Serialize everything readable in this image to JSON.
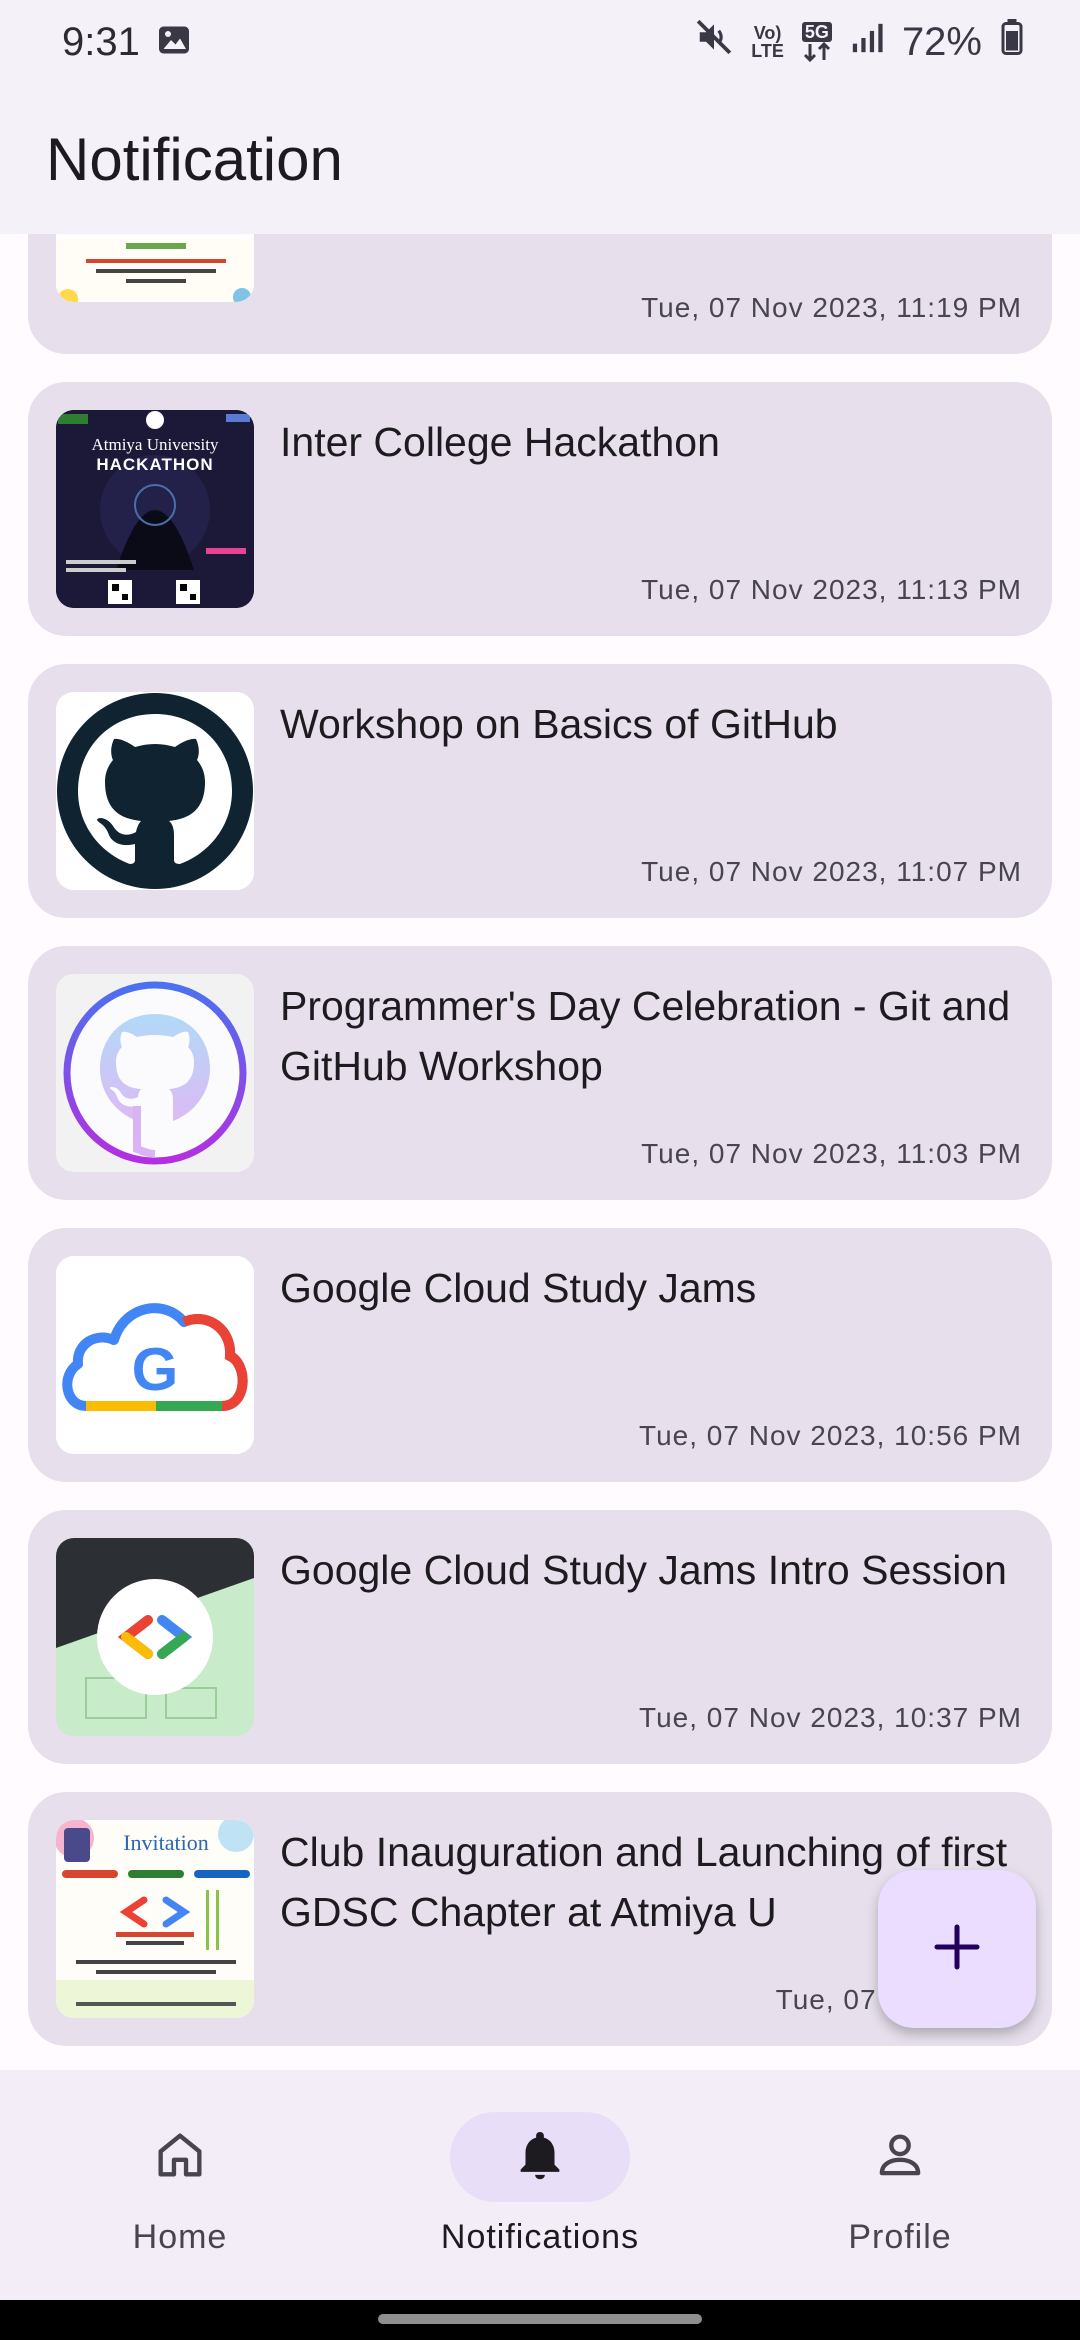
{
  "status_bar": {
    "time": "9:31",
    "volte_top": "Vo)",
    "volte_bottom": "LTE",
    "network": "5G",
    "battery": "72%"
  },
  "app_bar": {
    "title": "Notification"
  },
  "notifications": [
    {
      "title": "",
      "time": "Tue, 07 Nov 2023, 11:19 PM",
      "thumb": "invitation-poster"
    },
    {
      "title": "Inter College Hackathon",
      "time": "Tue, 07 Nov 2023, 11:13 PM",
      "thumb": "hackathon-poster",
      "thumb_text_1": "Atmiya University",
      "thumb_text_2": "HACKATHON"
    },
    {
      "title": "Workshop on Basics of GitHub",
      "time": "Tue, 07 Nov 2023, 11:07 PM",
      "thumb": "github-logo"
    },
    {
      "title": "Programmer's Day Celebration - Git and GitHub Workshop",
      "time": "Tue, 07 Nov 2023, 11:03 PM",
      "thumb": "github-gradient-logo"
    },
    {
      "title": "Google Cloud Study Jams",
      "time": "Tue, 07 Nov 2023, 10:56 PM",
      "thumb": "google-cloud-logo"
    },
    {
      "title": "Google Cloud Study Jams Intro Session",
      "time": "Tue, 07 Nov 2023, 10:37 PM",
      "thumb": "gdsc-code-logo"
    },
    {
      "title": "Club Inauguration and Launching of first GDSC Chapter at Atmiya U",
      "time": "Tue, 07 Nov 2023,",
      "thumb": "invitation-poster",
      "thumb_text_1": "Invitation"
    }
  ],
  "fab": {
    "icon": "plus-icon"
  },
  "bottom_nav": {
    "items": [
      {
        "label": "Home",
        "icon": "home-icon",
        "active": false
      },
      {
        "label": "Notifications",
        "icon": "bell-icon",
        "active": true
      },
      {
        "label": "Profile",
        "icon": "person-icon",
        "active": false
      }
    ]
  },
  "colors": {
    "surface": "#fffbfe",
    "card": "#e7e0ec",
    "fab": "#eaddff",
    "nav_active": "#e8def8",
    "accent_dark": "#21005d"
  }
}
